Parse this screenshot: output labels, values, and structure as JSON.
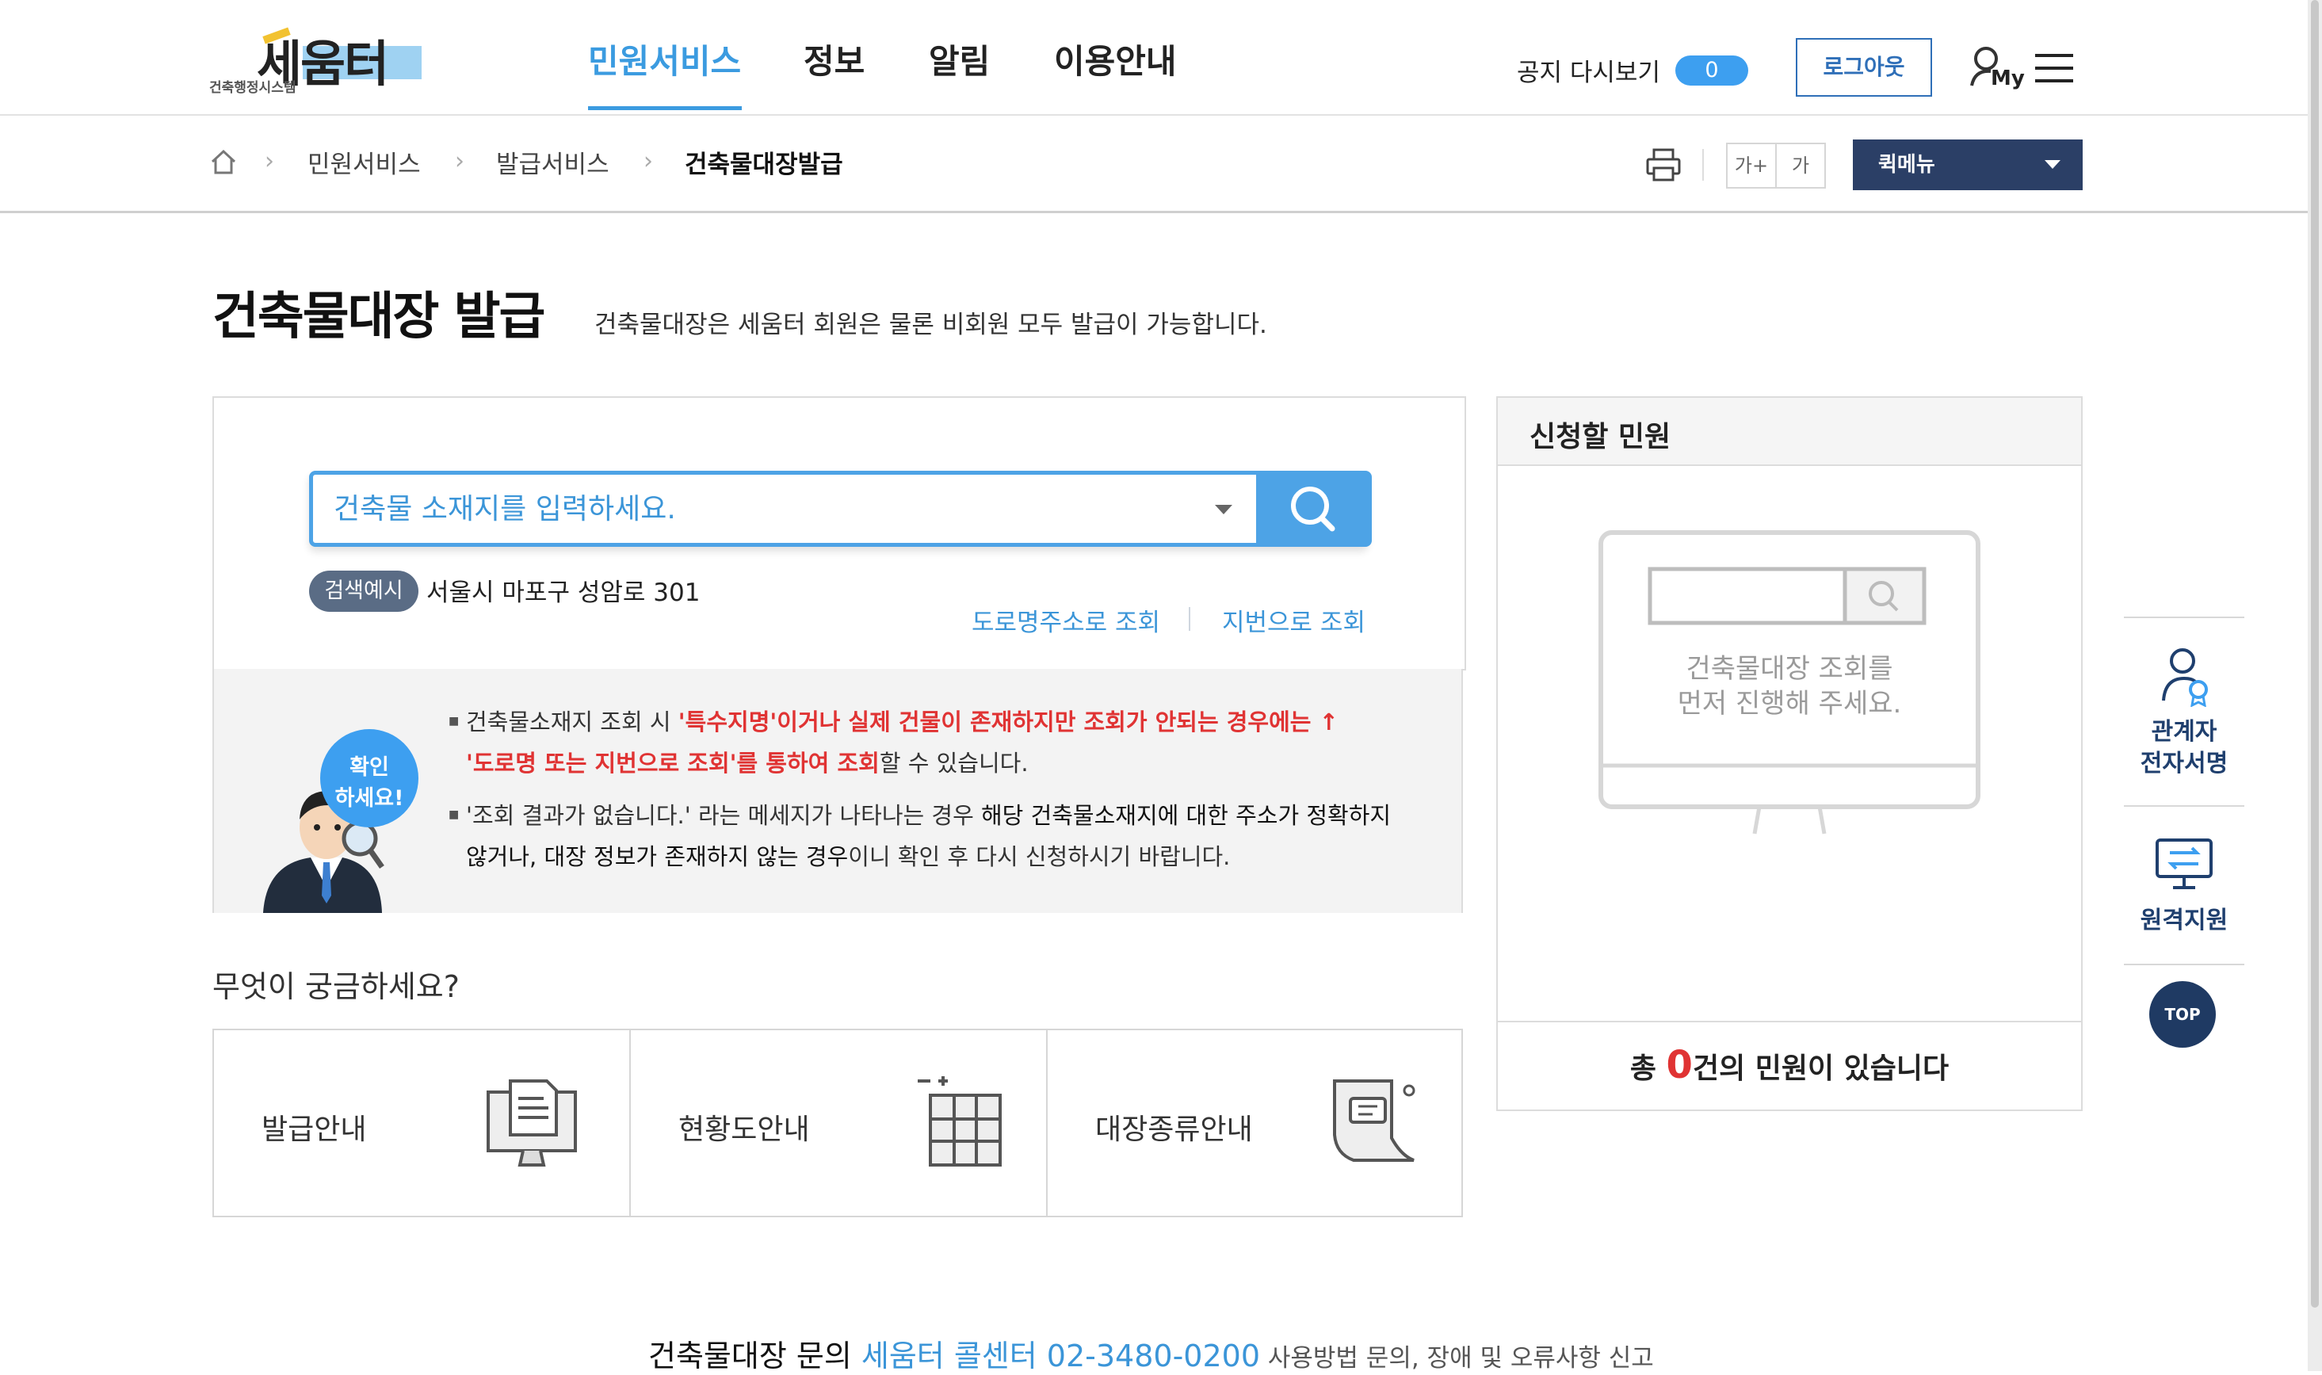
{
  "logo": {
    "main": "세움터",
    "sub": "건축행정시스템"
  },
  "nav": [
    {
      "label": "민원서비스",
      "active": true
    },
    {
      "label": "정보"
    },
    {
      "label": "알림"
    },
    {
      "label": "이용안내"
    }
  ],
  "header": {
    "notice_label": "공지 다시보기",
    "notice_count": "0",
    "logout_label": "로그아웃",
    "my_label": "My"
  },
  "breadcrumb": [
    "민원서비스",
    "발급서비스",
    "건축물대장발급"
  ],
  "toolbar": {
    "font_up": "가+",
    "font_down": "가",
    "quick_menu": "퀵메뉴"
  },
  "page": {
    "title": "건축물대장 발급",
    "subtitle": "건축물대장은 세움터 회원은 물론 비회원 모두 발급이 가능합니다."
  },
  "search": {
    "placeholder": "건축물 소재지를 입력하세요.",
    "example_badge": "검색예시",
    "example_text": "서울시 마포구 성암로 301",
    "road_lookup": "도로명주소로 조회",
    "lot_lookup": "지번으로 조회"
  },
  "notice": {
    "bubble_line1": "확인",
    "bubble_line2": "하세요!",
    "item1_a": "건축물소재지 조회 시 ",
    "item1_b": "'특수지명'이거나 실제 건물이 존재하지만 조회가 안되는 경우에는 ↑",
    "item1_c": "'도로명 또는 지번으로 조회'를 통하여 조회",
    "item1_d": "할 수 있습니다.",
    "item2_a": "'조회 결과가 없습니다.' 라는 메세지가 나타나는 경우 ",
    "item2_b": "해당 건축물소재지에 대한 주소가 정확하지",
    "item2_c": "않거나, 대장 정보가 존재하지 않는 경우",
    "item2_d": "이니 확인 후 다시 신청하시기 바랍니다."
  },
  "faq": {
    "title": "무엇이 궁금하세요?",
    "items": [
      "발급안내",
      "현황도안내",
      "대장종류안내"
    ]
  },
  "apply": {
    "title": "신청할 민원",
    "empty_line1": "건축물대장 조회를",
    "empty_line2": "먼저 진행해 주세요.",
    "count_prefix": "총 ",
    "count": "0",
    "count_suffix": "건의 민원이 있습니다"
  },
  "quickbar": {
    "esign_line1": "관계자",
    "esign_line2": "전자서명",
    "remote": "원격지원",
    "top": "TOP"
  },
  "footer": {
    "prefix": "건축물대장 문의 ",
    "callcenter": "세움터 콜센터 02-3480-0200",
    "suffix": " 사용방법 문의, 장애 및 오류사항 신고"
  },
  "colors": {
    "accent": "#3b9be0",
    "navy": "#2b3f66",
    "alert": "#e03333"
  }
}
